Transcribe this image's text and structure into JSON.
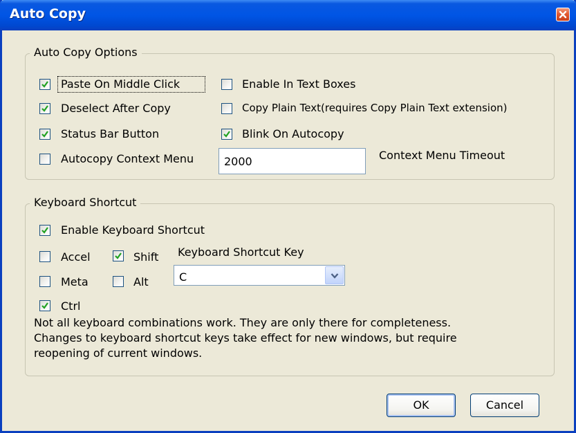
{
  "window": {
    "title": "Auto Copy"
  },
  "auto_copy_options": {
    "legend": "Auto Copy Options",
    "paste_middle_click": {
      "label": "Paste On Middle Click",
      "checked": true
    },
    "deselect_after_copy": {
      "label": "Deselect After Copy",
      "checked": true
    },
    "status_bar_button": {
      "label": "Status Bar Button",
      "checked": true
    },
    "context_menu": {
      "label": "Autocopy Context Menu",
      "checked": false
    },
    "enable_text_boxes": {
      "label": "Enable In Text Boxes",
      "checked": false
    },
    "copy_plain_text": {
      "label": "Copy Plain Text(requires Copy Plain Text extension)",
      "checked": false
    },
    "blink_on_autocopy": {
      "label": "Blink On Autocopy",
      "checked": true
    },
    "timeout": {
      "value": "2000",
      "label": "Context Menu Timeout"
    }
  },
  "keyboard_shortcut": {
    "legend": "Keyboard Shortcut",
    "enable": {
      "label": "Enable Keyboard Shortcut",
      "checked": true
    },
    "accel": {
      "label": "Accel",
      "checked": false
    },
    "shift": {
      "label": "Shift",
      "checked": true
    },
    "meta": {
      "label": "Meta",
      "checked": false
    },
    "alt": {
      "label": "Alt",
      "checked": false
    },
    "ctrl": {
      "label": "Ctrl",
      "checked": true
    },
    "key_label": "Keyboard Shortcut Key",
    "key_value": "C",
    "info_line1": "Not all keyboard combinations work. They are only there for completeness.",
    "info_line2": "Changes to keyboard shortcut keys take effect for new windows, but require",
    "info_line3": "reopening of current windows."
  },
  "buttons": {
    "ok": "OK",
    "cancel": "Cancel"
  },
  "icons": {
    "check": "checkmark-icon",
    "close": "close-icon",
    "dropdown": "chevron-down-icon"
  },
  "colors": {
    "title_bar": "#0055e5",
    "dialog_bg": "#ece9d8",
    "check": "#21a121"
  }
}
